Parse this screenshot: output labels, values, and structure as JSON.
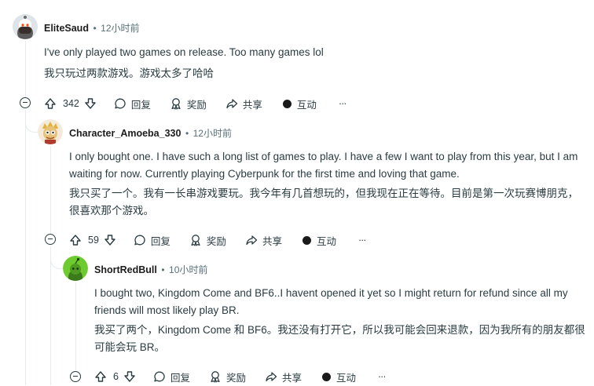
{
  "comments": [
    {
      "username": "EliteSaud",
      "sep": "•",
      "time": "12小时前",
      "text_en": "I've only played two games on release. Too many games lol",
      "text_zh": "我只玩过两款游戏。游戏太多了哈哈",
      "votes": "342",
      "reply": "回复",
      "award": "奖励",
      "share": "共享",
      "interact": "互动",
      "more": "···"
    },
    {
      "username": "Character_Amoeba_330",
      "sep": "•",
      "time": "12小时前",
      "text_en": "I only bought one. I have such a long list of games to play. I have a few I want to play from this year, but I am waiting for now. Currently playing Cyberpunk for the first time and loving that game.",
      "text_zh": "我只买了一个。我有一长串游戏要玩。我今年有几首想玩的，但我现在正在等待。目前是第一次玩赛博朋克，很喜欢那个游戏。",
      "votes": "59",
      "reply": "回复",
      "award": "奖励",
      "share": "共享",
      "interact": "互动",
      "more": "···"
    },
    {
      "username": "ShortRedBull",
      "sep": "•",
      "time": "10小时前",
      "text_en": "I bought two, Kingdom Come and BF6..I havent opened it yet so I might return for refund since all my friends will most likely play BR.",
      "text_zh": "我买了两个，Kingdom Come 和 BF6。我还没有打开它，所以我可能会回来退款，因为我所有的朋友都很可能会玩 BR。",
      "votes": "6",
      "reply": "回复",
      "award": "奖励",
      "share": "共享",
      "interact": "互动",
      "more": "···"
    }
  ]
}
